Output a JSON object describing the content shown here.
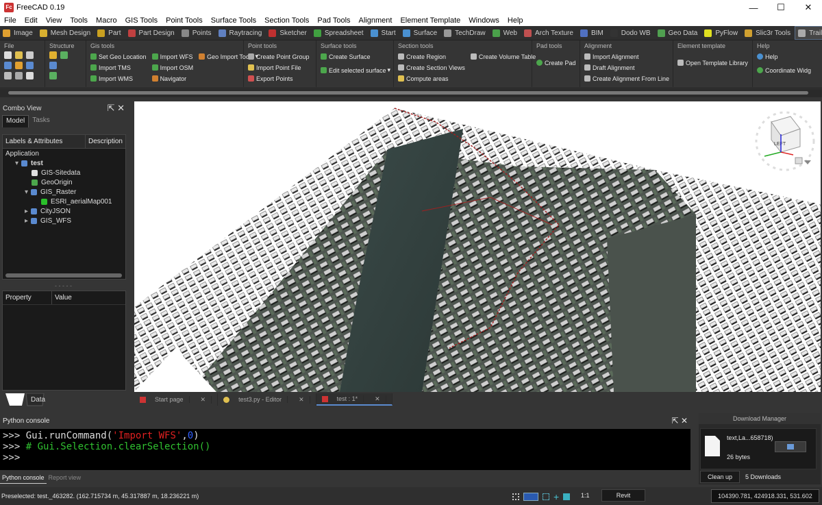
{
  "app_title": "FreeCAD 0.19",
  "menus": [
    "File",
    "Edit",
    "View",
    "Tools",
    "Macro",
    "GIS Tools",
    "Point Tools",
    "Surface Tools",
    "Section Tools",
    "Pad Tools",
    "Alignment",
    "Element Template",
    "Windows",
    "Help"
  ],
  "workbenches": [
    {
      "label": "Image",
      "color": "#e0a030"
    },
    {
      "label": "Mesh Design",
      "color": "#d8b030"
    },
    {
      "label": "Part",
      "color": "#c9a020"
    },
    {
      "label": "Part Design",
      "color": "#c04040"
    },
    {
      "label": "Points",
      "color": "#888"
    },
    {
      "label": "Raytracing",
      "color": "#6080c0"
    },
    {
      "label": "Sketcher",
      "color": "#c03030"
    },
    {
      "label": "Spreadsheet",
      "color": "#40a040"
    },
    {
      "label": "Start",
      "color": "#4a90d0"
    },
    {
      "label": "Surface",
      "color": "#4a90d0"
    },
    {
      "label": "TechDraw",
      "color": "#999"
    },
    {
      "label": "Web",
      "color": "#4aa04a"
    },
    {
      "label": "Arch Texture",
      "color": "#c05050"
    },
    {
      "label": "BIM",
      "color": "#5070c0"
    },
    {
      "label": "Dodo WB",
      "color": "#333"
    },
    {
      "label": "Geo Data",
      "color": "#50a050"
    },
    {
      "label": "PyFlow",
      "color": "#e0e020"
    },
    {
      "label": "Slic3r Tools",
      "color": "#d0a030"
    },
    {
      "label": "Trails (alpha)",
      "color": "#aaa"
    }
  ],
  "ribbon": {
    "file": {
      "title": "File"
    },
    "structure": {
      "title": "Structure"
    },
    "gis": {
      "title": "Gis tools",
      "c1": [
        "Set Geo Location",
        "Import TMS",
        "Import WMS"
      ],
      "c2": [
        "Import WFS",
        "Import OSM",
        "Navigator"
      ],
      "c3": [
        "Geo Import Tools"
      ]
    },
    "point": {
      "title": "Point tools",
      "items": [
        "Create Point Group",
        "Import Point File",
        "Export Points"
      ]
    },
    "surface": {
      "title": "Surface tools",
      "items": [
        "Create Surface",
        "Edit selected surface"
      ]
    },
    "section": {
      "title": "Section tools",
      "c1": [
        "Create Region",
        "Create Section Views",
        "Compute areas"
      ],
      "c2": [
        "Create Volume Table"
      ]
    },
    "pad": {
      "title": "Pad tools",
      "items": [
        "Create Pad"
      ]
    },
    "alignment": {
      "title": "Alignment",
      "items": [
        "Import Alignment",
        "Draft Alignment",
        "Create Alignment From Line"
      ]
    },
    "elemtpl": {
      "title": "Element template",
      "items": [
        "Open Template Library"
      ]
    },
    "help": {
      "title": "Help",
      "items": [
        "Help",
        "Coordinate Widg"
      ]
    }
  },
  "combo": {
    "title": "Combo View",
    "tabs": [
      "Model",
      "Tasks"
    ],
    "col_labels": "Labels & Attributes",
    "col_desc": "Description",
    "tree": [
      {
        "label": "Application",
        "indent": 0,
        "bold": false
      },
      {
        "label": "test",
        "indent": 1,
        "bold": true
      },
      {
        "label": "GIS-Sitedata",
        "indent": 2,
        "bold": false
      },
      {
        "label": "GeoOrigin",
        "indent": 2,
        "bold": false
      },
      {
        "label": "GIS_Raster",
        "indent": 2,
        "bold": false
      },
      {
        "label": "ESRI_aerialMap001",
        "indent": 3,
        "bold": false
      },
      {
        "label": "CityJSON",
        "indent": 2,
        "bold": false
      },
      {
        "label": "GIS_WFS",
        "indent": 2,
        "bold": false
      }
    ],
    "prop_col1": "Property",
    "prop_col2": "Value",
    "data_tab": "Data"
  },
  "doc_tabs": [
    "Start page",
    "test3.py - Editor",
    "test : 1*"
  ],
  "navcube_label": "LEFT",
  "console": {
    "title": "Python console",
    "line1_prompt": ">>> ",
    "line1_fn": "Gui.runCommand(",
    "line1_str": "'Import WFS'",
    "line1_sep": ",",
    "line1_num": "0",
    "line1_end": ")",
    "line2_prompt": ">>> ",
    "line2_comment": "# Gui.Selection.clearSelection()",
    "line3_prompt": ">>> ",
    "tabs": [
      "Python console",
      "Report view"
    ]
  },
  "download": {
    "title": "Download Manager",
    "file": "text,La...658718)",
    "size": "26 bytes",
    "cleanup": "Clean up",
    "count": "5 Downloads"
  },
  "status": {
    "preselected": "Preselected: test._463282. (162.715734 m, 45.317887 m, 18.236221 m)",
    "ratio": "1:1",
    "nav": "Revit",
    "coords": "104390.781, 424918.331, 531.602"
  }
}
